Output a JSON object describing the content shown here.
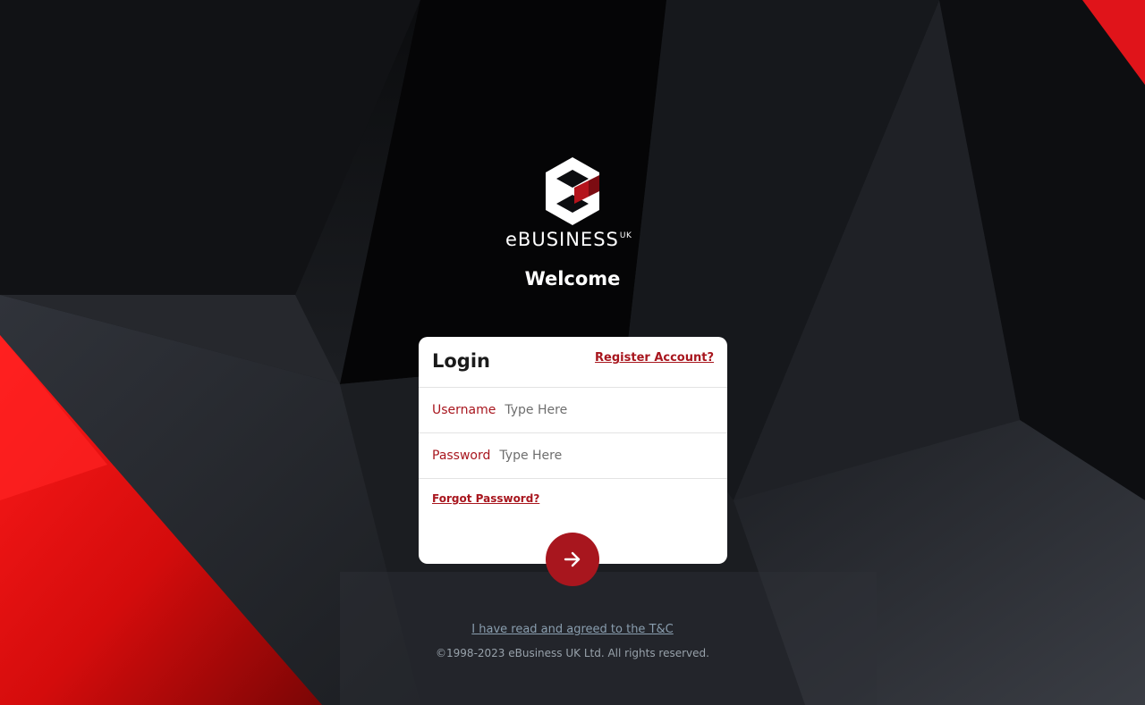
{
  "brand": {
    "name": "eBUSINESS",
    "suffix": "UK",
    "logo_icon": "ebusiness-hexagon-e-logo",
    "accent_color": "#a8161e"
  },
  "welcome": "Welcome",
  "login": {
    "title": "Login",
    "register_link": "Register Account?",
    "username": {
      "label": "Username",
      "placeholder": "Type Here",
      "value": ""
    },
    "password": {
      "label": "Password",
      "placeholder": "Type Here",
      "value": ""
    },
    "forgot_link": "Forgot Password?",
    "submit_icon": "arrow-right-icon"
  },
  "footer": {
    "terms_link": "I have read and agreed to the T&C",
    "copyright": "©1998-2023 eBusiness UK Ltd. All rights reserved."
  }
}
